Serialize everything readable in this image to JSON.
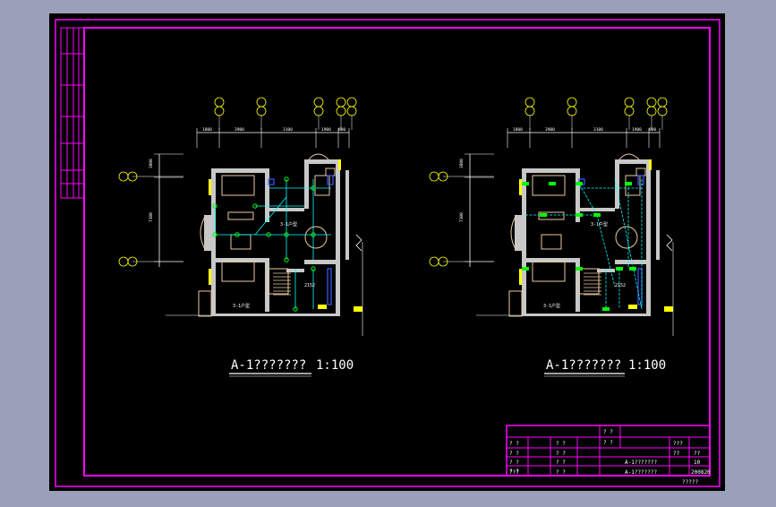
{
  "colors": {
    "background": "#9aa0b8",
    "sheet": "#000000",
    "frame": "#ff00ff",
    "wall": "#c8c8c8",
    "furniture": "#e8c8a0",
    "wire": "#00ffff",
    "device": "#00ff00",
    "axis": "#ffff00",
    "text": "#ffffff",
    "accent_blue": "#3a5cff",
    "accent_magenta": "#ff00ff"
  },
  "plans": [
    {
      "title": "A-1???????",
      "scale": "1:100",
      "dims_top": [
        "1800",
        "3900",
        "3100",
        "1900",
        "800"
      ],
      "dims_left": [
        "3800",
        "7300"
      ],
      "axis_top": [
        "⑩",
        "⑪",
        "⑫",
        "⑬",
        "⑭",
        "⑮",
        "⑯",
        "⑰"
      ],
      "axis_left": [
        "Ⓐ",
        "Ⓙ",
        "Ⓔ",
        "Ⓗ"
      ],
      "room_labels": [
        "3-1户型",
        "3-1户型"
      ],
      "mark_label": "2152"
    },
    {
      "title": "A-1???????",
      "scale": "1:100",
      "dims_top": [
        "1800",
        "3900",
        "3100",
        "1900",
        "800"
      ],
      "dims_left": [
        "3800",
        "7300"
      ],
      "axis_top": [
        "⑩",
        "⑪",
        "⑫",
        "⑬",
        "⑭",
        "⑮",
        "⑯",
        "⑰"
      ],
      "axis_left": [
        "Ⓐ",
        "Ⓙ",
        "Ⓔ",
        "Ⓗ"
      ],
      "room_labels": [
        "3-1户型",
        "3-1户型"
      ],
      "mark_label": "2152"
    }
  ],
  "title_block": {
    "row_a": [
      "? ?",
      "? ?"
    ],
    "row_b": [
      "? ?",
      "? ?",
      "? ?",
      "???"
    ],
    "row_c": [
      "? ?",
      "? ?",
      "??",
      "??"
    ],
    "row_d": [
      "? ?",
      "? ?",
      "A-1???????",
      "10"
    ],
    "row_e": [
      "???",
      "? ?",
      "A-1???????",
      "200820"
    ],
    "footer": "?????"
  }
}
